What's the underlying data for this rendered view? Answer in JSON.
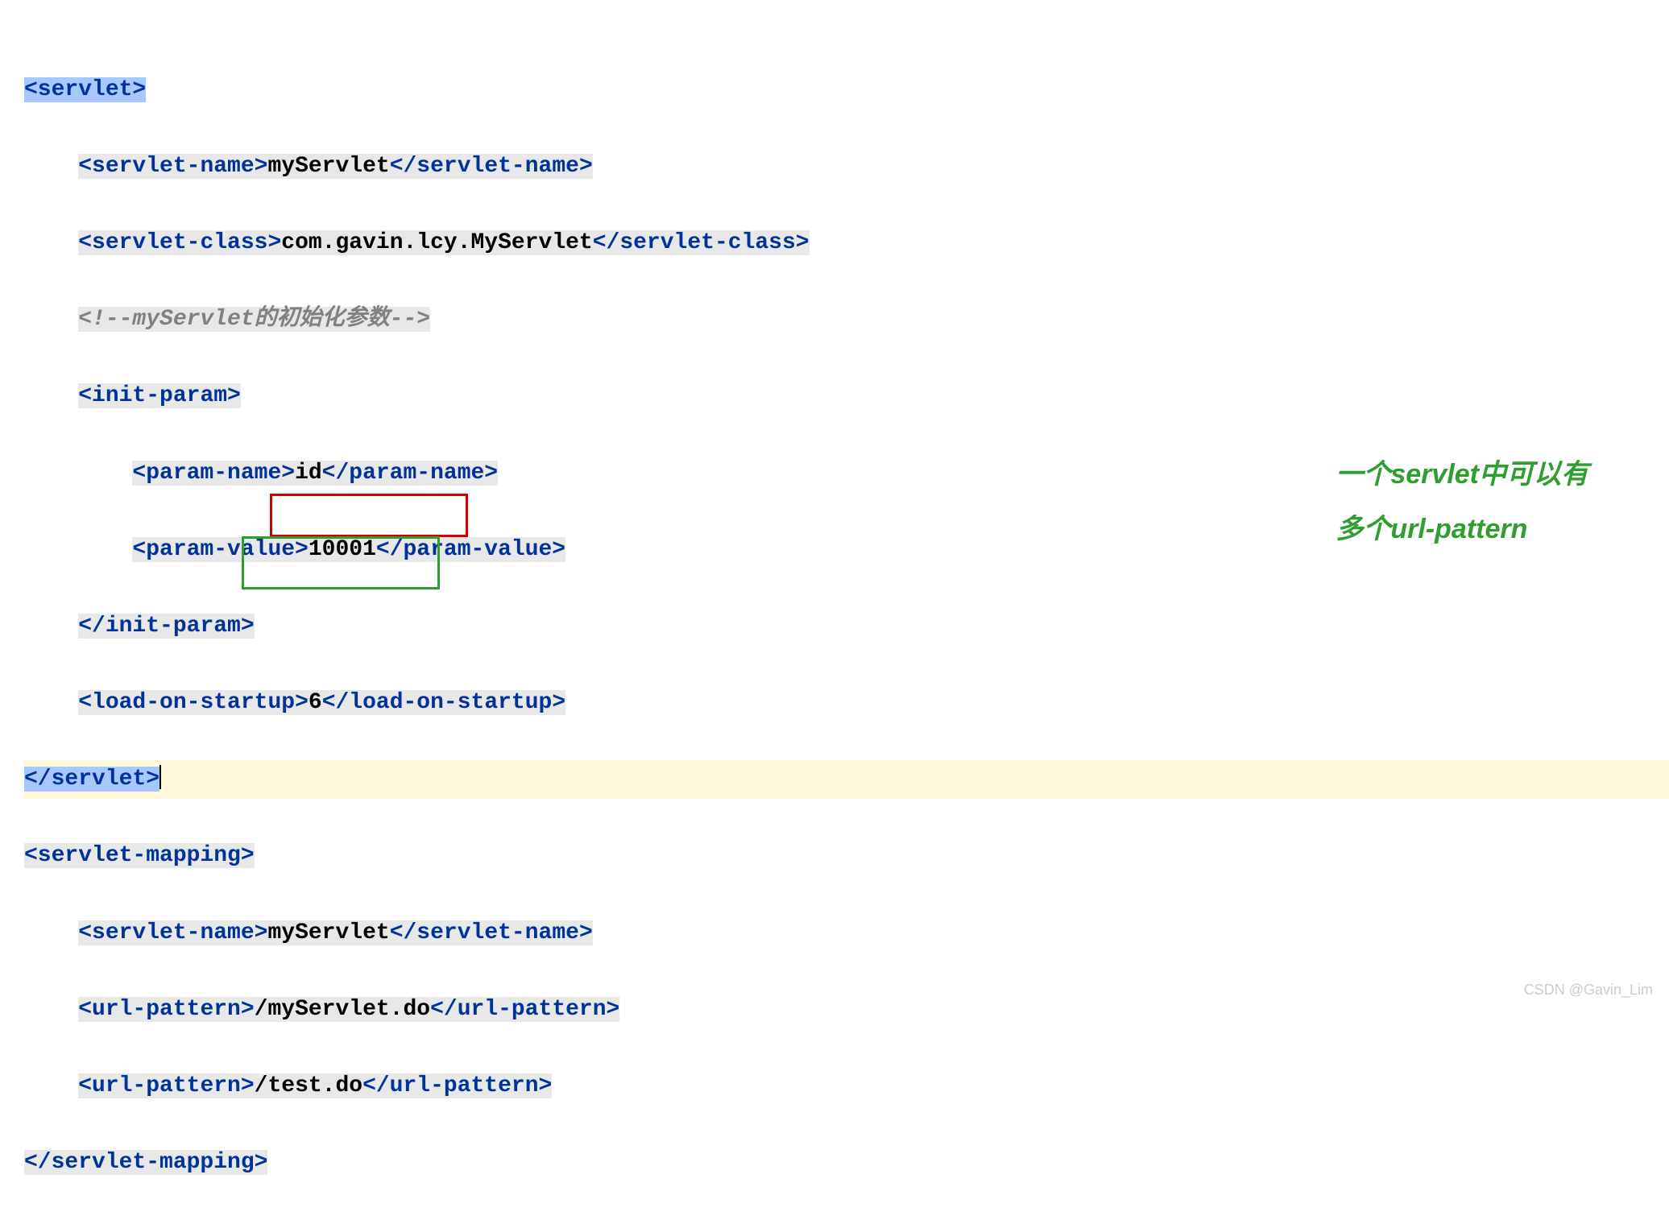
{
  "lines": {
    "l1": {
      "open": "<servlet>"
    },
    "l2": {
      "open": "<servlet-name>",
      "text": "myServlet",
      "close": "</servlet-name>"
    },
    "l3": {
      "open": "<servlet-class>",
      "text": "com.gavin.lcy.MyServlet",
      "close": "</servlet-class>"
    },
    "l4": {
      "comment": "<!--myServlet的初始化参数-->"
    },
    "l5": {
      "open": "<init-param>"
    },
    "l6": {
      "open": "<param-name>",
      "text": "id",
      "close": "</param-name>"
    },
    "l7": {
      "open": "<param-value>",
      "text": "10001",
      "close": "</param-value>"
    },
    "l8": {
      "close": "</init-param>"
    },
    "l9": {
      "open": "<load-on-startup>",
      "text": "6",
      "close": "</load-on-startup>"
    },
    "l10": {
      "close": "</servlet>"
    },
    "l11": {
      "open": "<servlet-mapping>"
    },
    "l12": {
      "open": "<servlet-name>",
      "text": "myServlet",
      "close": "</servlet-name>"
    },
    "l13": {
      "open": "<url-pattern>",
      "text": "/myServlet.do",
      "close": "</url-pattern>"
    },
    "l14": {
      "open": "<url-pattern>",
      "text": "/test.do",
      "close": "</url-pattern>"
    },
    "l15": {
      "close": "</servlet-mapping>"
    }
  },
  "annotation": {
    "line1": "一个servlet中可以有",
    "line2": "多个url-pattern"
  },
  "watermark": "CSDN @Gavin_Lim"
}
